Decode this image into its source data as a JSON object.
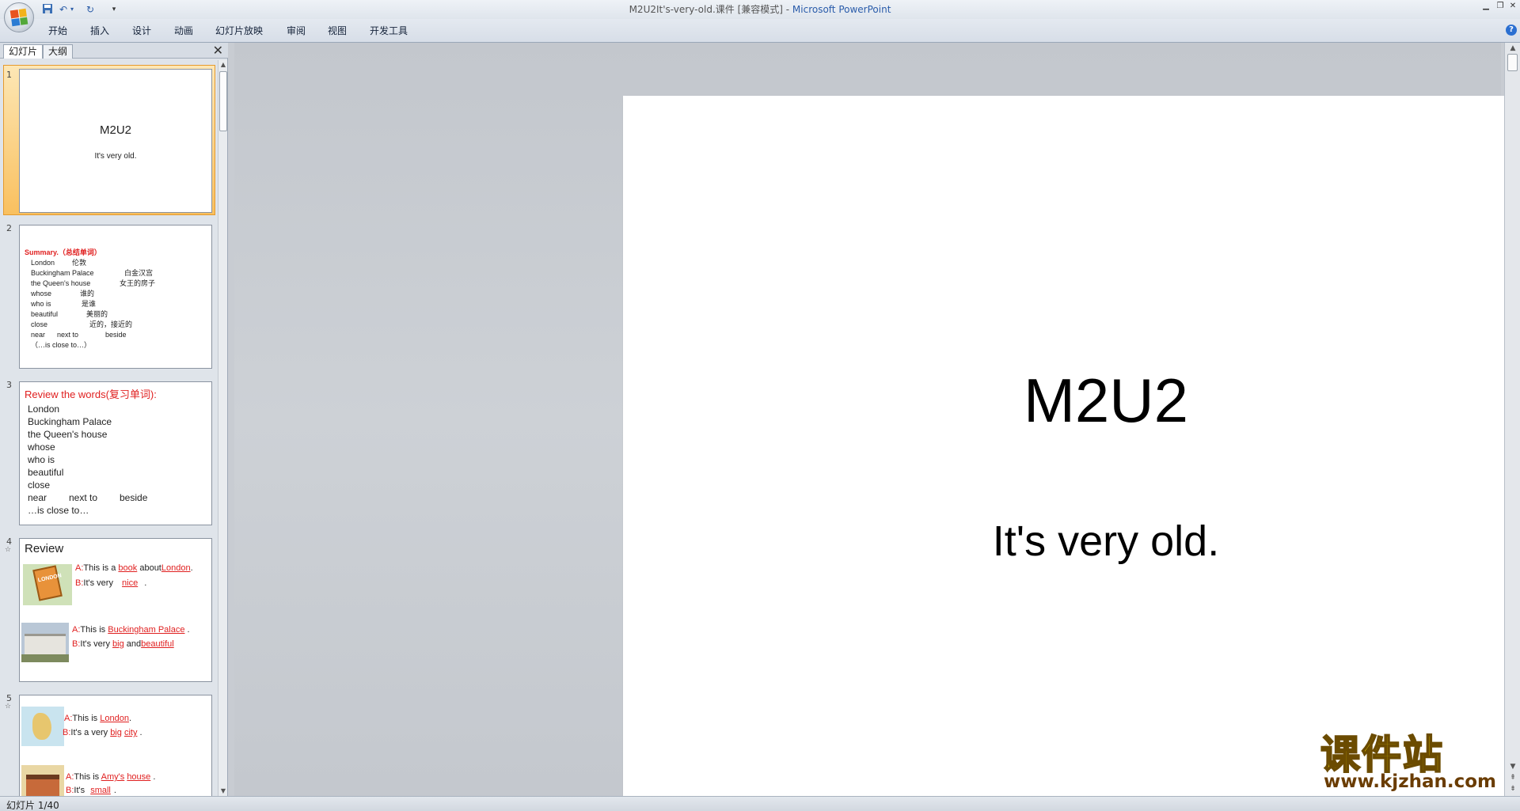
{
  "window": {
    "title_doc": "M2U2It's-very-old.课件 [兼容模式] - ",
    "title_app": "Microsoft PowerPoint"
  },
  "quick_access": {
    "save_icon": "save-icon",
    "undo_icon": "undo-icon",
    "redo_icon": "redo-icon",
    "customize": "▾"
  },
  "ribbon": {
    "tabs": [
      "开始",
      "插入",
      "设计",
      "动画",
      "幻灯片放映",
      "审阅",
      "视图",
      "开发工具"
    ]
  },
  "pane": {
    "tab_slides": "幻灯片",
    "tab_outline": "大纲",
    "close": "✕"
  },
  "slides": [
    {
      "num": "1",
      "title": "M2U2",
      "subtitle": "It's very old."
    },
    {
      "num": "2",
      "heading": "Summary.（总结单词）",
      "rows": [
        [
          "London",
          "伦敦"
        ],
        [
          "Buckingham Palace",
          "白金汉宫"
        ],
        [
          "the Queen's house",
          "女王的房子"
        ],
        [
          "whose",
          "谁的"
        ],
        [
          "who is",
          "是谁"
        ],
        [
          "beautiful",
          "美丽的"
        ],
        [
          "close",
          "近的，接近的"
        ],
        [
          "near      next to",
          "beside"
        ]
      ],
      "last_line": "（…is close to…）"
    },
    {
      "num": "3",
      "heading": "Review the words(复习单词):",
      "words": [
        "London",
        "Buckingham Palace",
        "the Queen's house",
        "whose",
        "who is",
        "beautiful",
        "close"
      ],
      "near_row": [
        "near",
        "next to",
        "beside"
      ],
      "last_line": "…is close to…"
    },
    {
      "num": "4",
      "heading": "Review",
      "a1_pre": "This is a ",
      "a1_word1": "book",
      "a1_mid": " about",
      "a1_word2": "London",
      "b1_pre": "It's very ",
      "b1_word": "nice",
      "a2_pre": "This is ",
      "a2_word": "Buckingham Palace",
      "b2_pre": "It's very ",
      "b2_word1": "big",
      "b2_mid": " and",
      "b2_word2": "beautiful",
      "img1_label": "LONDON"
    },
    {
      "num": "5",
      "a1_pre": "This is ",
      "a1_word": "London",
      "b1_pre": "It's a very ",
      "b1_word1": "big",
      "b1_word2": "city",
      "a2_pre": "This is ",
      "a2_word1": "Amy's",
      "a2_word2": "house",
      "b2_pre": "It's ",
      "b2_word": "small"
    }
  ],
  "labels": {
    "a": "A:",
    "b": "B:"
  },
  "main_slide": {
    "title": "M2U2",
    "subtitle": "It's very old."
  },
  "status": {
    "text": "幻灯片 1/40"
  },
  "watermark": {
    "cn": "课件站",
    "url": "www.kjzhan.com"
  },
  "colors": {
    "accent_red": "#e02020",
    "selection": "#f9c05f",
    "watermark_yellow": "#ffe600"
  }
}
